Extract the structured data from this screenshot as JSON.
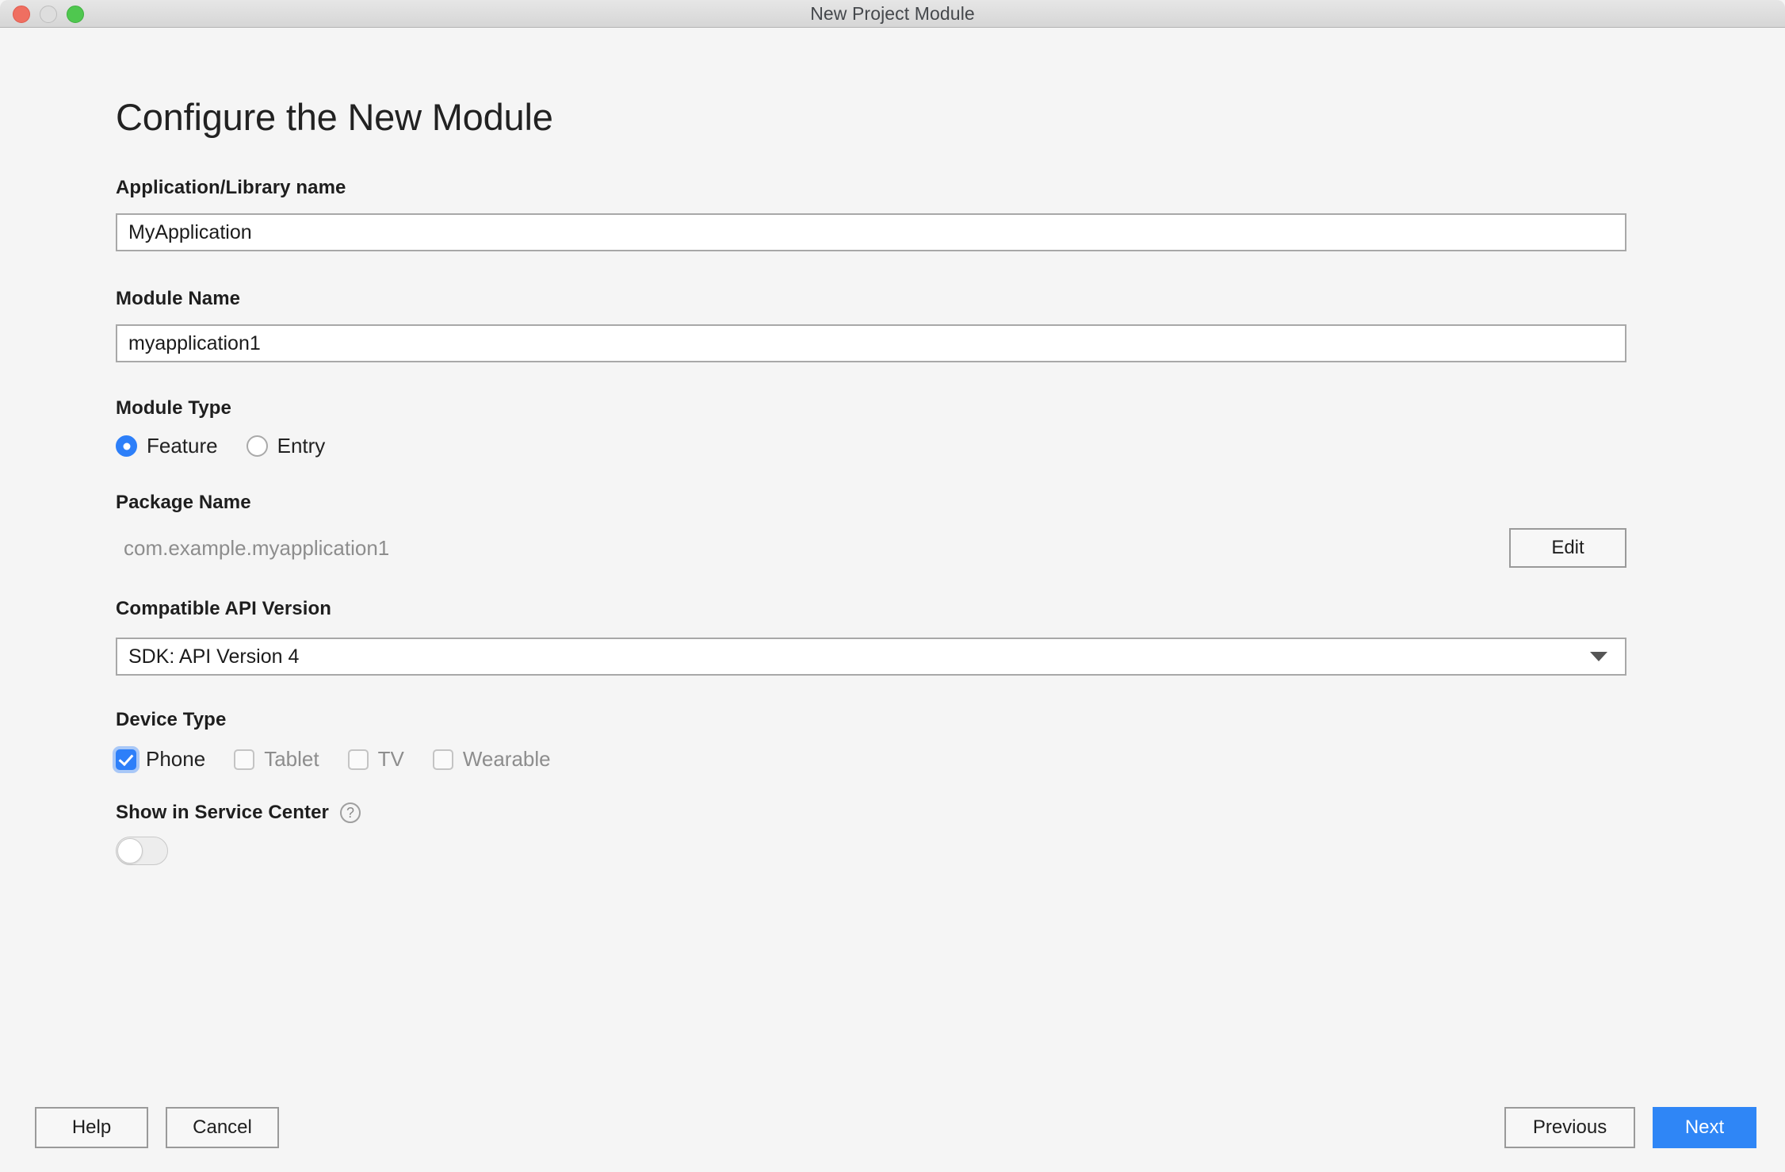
{
  "window": {
    "title": "New Project Module",
    "traffic_lights": [
      "close",
      "minimize",
      "maximize"
    ]
  },
  "page": {
    "heading": "Configure the New Module"
  },
  "fields": {
    "app_name": {
      "label": "Application/Library name",
      "value": "MyApplication",
      "placeholder": "Application/Library name"
    },
    "module_name": {
      "label": "Module Name",
      "value": "myapplication1",
      "placeholder": "Module Name"
    },
    "module_type": {
      "label": "Module Type",
      "options": [
        {
          "label": "Feature",
          "selected": true
        },
        {
          "label": "Entry",
          "selected": false
        }
      ]
    },
    "package_name": {
      "label": "Package Name",
      "value": "com.example.myapplication1",
      "edit_label": "Edit"
    },
    "api_version": {
      "label": "Compatible API Version",
      "value": "SDK: API Version 4"
    },
    "device_type": {
      "label": "Device Type",
      "options": [
        {
          "label": "Phone",
          "checked": true,
          "enabled": true
        },
        {
          "label": "Tablet",
          "checked": false,
          "enabled": false
        },
        {
          "label": "TV",
          "checked": false,
          "enabled": false
        },
        {
          "label": "Wearable",
          "checked": false,
          "enabled": false
        }
      ]
    },
    "service_center": {
      "label": "Show in Service Center",
      "help_glyph": "?",
      "toggle_on": false
    }
  },
  "footer": {
    "help_label": "Help",
    "cancel_label": "Cancel",
    "previous_label": "Previous",
    "next_label": "Next"
  },
  "colors": {
    "accent_blue": "#2d7ff9",
    "primary_button": "#2f86f6",
    "window_background": "#f5f5f5",
    "muted_text": "#8d8d8d"
  }
}
